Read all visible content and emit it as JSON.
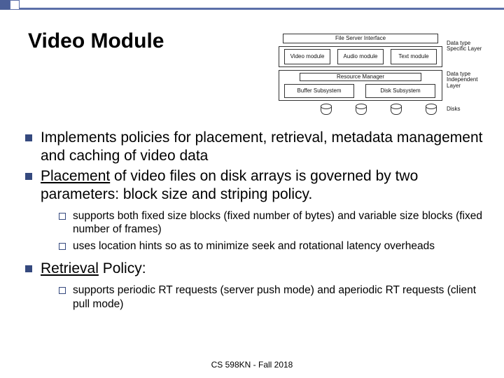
{
  "title": "Video Module",
  "bullets": [
    {
      "text": "Implements policies for placement, retrieval, metadata management and caching of video data"
    },
    {
      "underline_prefix": "Placement",
      "rest": " of video files on disk arrays is governed by two parameters: block size and striping policy.",
      "subs": [
        "supports both fixed size blocks  (fixed number of bytes) and variable size blocks (fixed number of frames)",
        "uses location hints so as to minimize seek and rotational latency overheads"
      ]
    },
    {
      "underline_prefix": "Retrieval",
      "rest": " Policy:",
      "subs": [
        "supports periodic RT requests (server push mode) and aperiodic RT requests (client pull mode)"
      ]
    }
  ],
  "diagram": {
    "top_bar": "File Server Interface",
    "mod1": "Video module",
    "mod2": "Audio module",
    "mod3": "Text module",
    "label_top": "Data type Specific Layer",
    "res_mgr": "Resource Manager",
    "sub1": "Buffer Subsystem",
    "sub2": "Disk Subsystem",
    "label_bot": "Data type Independent Layer",
    "disks": "Disks"
  },
  "footer": "CS 598KN - Fall 2018"
}
